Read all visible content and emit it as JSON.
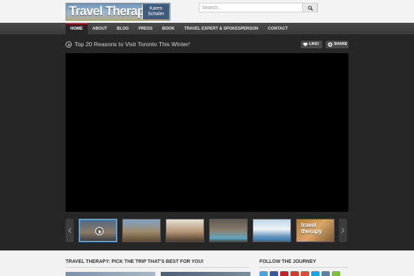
{
  "header": {
    "logo_title": "Travel Therapy",
    "logo_name_first": "Karen",
    "logo_name_last": "Schaler",
    "search_placeholder": "Search..."
  },
  "nav": {
    "items": [
      {
        "label": "HOME",
        "active": true
      },
      {
        "label": "ABOUT"
      },
      {
        "label": "BLOG"
      },
      {
        "label": "PRESS"
      },
      {
        "label": "BOOK"
      },
      {
        "label": "TRAVEL EXPERT & SPOKESPERSON"
      },
      {
        "label": "CONTACT"
      }
    ]
  },
  "video": {
    "title": "Top 20 Reasons to Visit Toronto This Winter!",
    "like_label": "LIKE!",
    "share_label": "SHARE"
  },
  "thumbnails": {
    "last_thumb_text_1": "travel",
    "last_thumb_text_2": "therapy"
  },
  "bottom": {
    "left_heading": "TRAVEL THERAPY: PICK THE TRIP THAT'S BEST FOR YOU!",
    "right_heading": "FOLLOW THE JOURNEY"
  },
  "social_icons": [
    {
      "name": "twitter-icon",
      "color": "#4aa3df"
    },
    {
      "name": "facebook-icon",
      "color": "#3b5998"
    },
    {
      "name": "pinterest-icon",
      "color": "#c8232c"
    },
    {
      "name": "youtube-icon",
      "color": "#d33a2c"
    },
    {
      "name": "google-plus-icon",
      "color": "#dd4b39"
    },
    {
      "name": "skype-icon",
      "color": "#12a5e8"
    },
    {
      "name": "email-icon",
      "color": "#5c7fa3"
    },
    {
      "name": "rss-icon",
      "color": "#7bbf3a"
    }
  ],
  "colors": {
    "nav_active_accent": "#c8252c",
    "thumb_active_border": "#5aa4d6",
    "video_bg": "#000000",
    "main_bg": "#262626"
  }
}
